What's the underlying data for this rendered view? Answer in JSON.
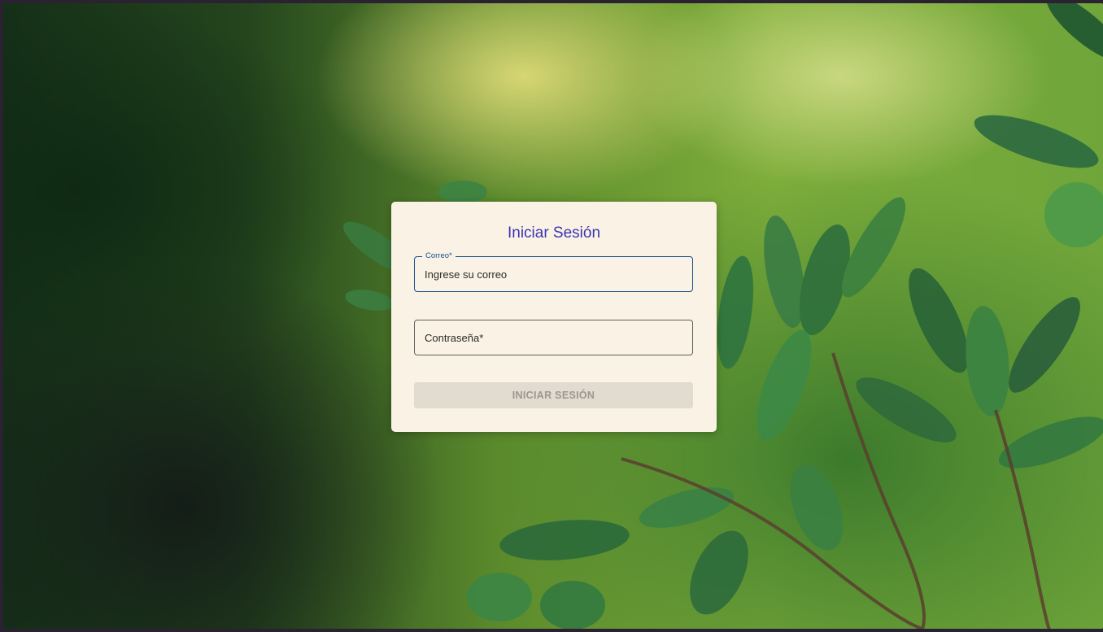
{
  "login": {
    "title": "Iniciar Sesión",
    "email": {
      "label": "Correo*",
      "placeholder": "Ingrese su correo",
      "value": ""
    },
    "password": {
      "placeholder": "Contraseña*",
      "value": ""
    },
    "submit_label": "INICIAR SESIÓN"
  },
  "colors": {
    "title": "#3a35b5",
    "focus_border": "#1a4f8e",
    "card_background": "#faf2e4",
    "disabled_button": "#e1dbd0"
  }
}
